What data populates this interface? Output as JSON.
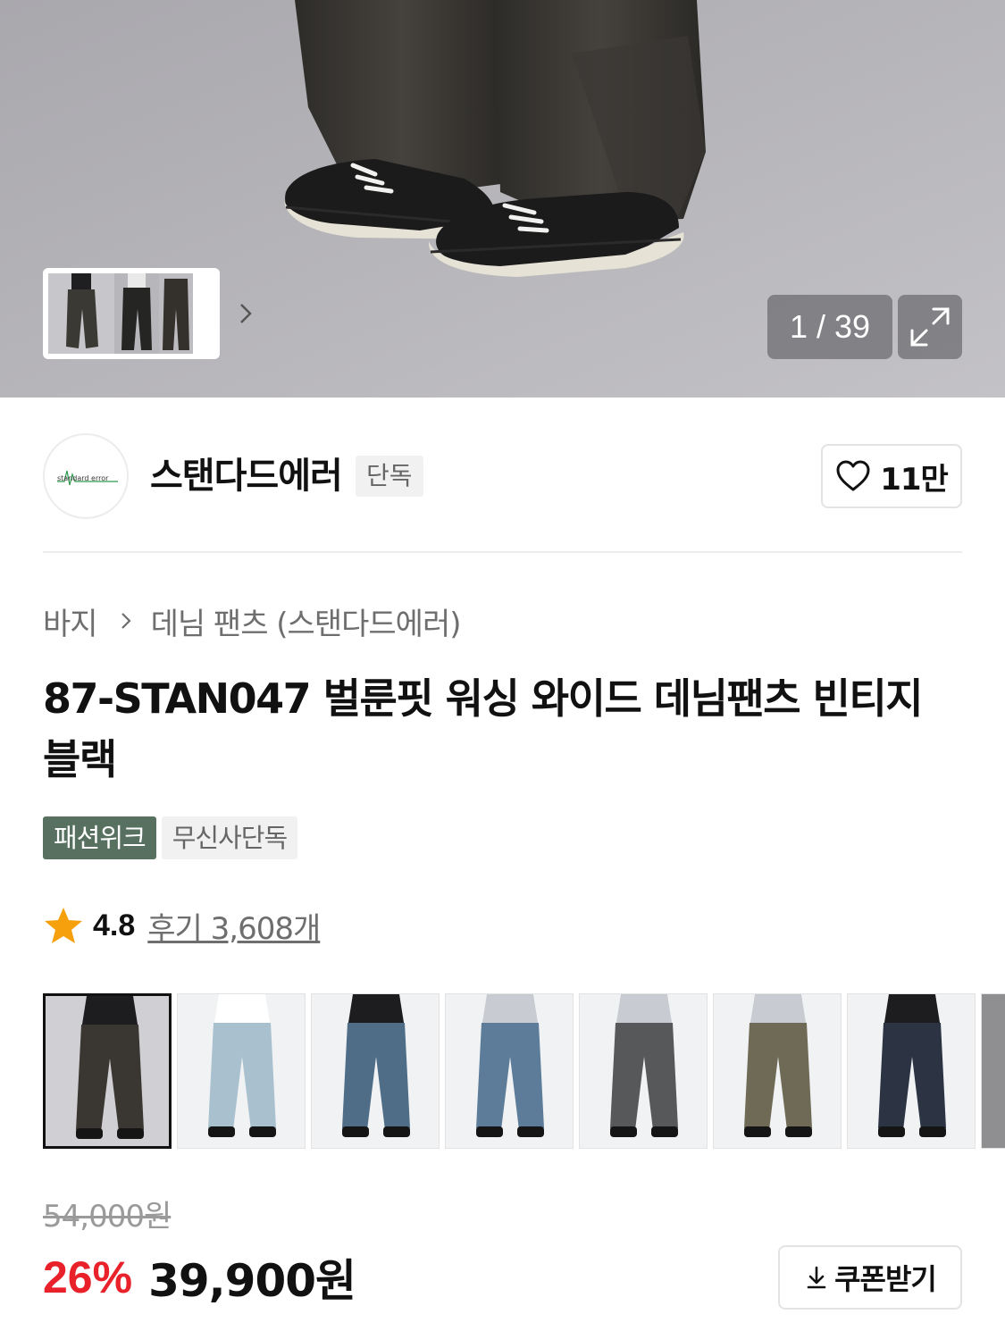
{
  "gallery": {
    "counter": "1 / 39",
    "next_icon": "chevron-right-icon",
    "expand_icon": "expand-icon"
  },
  "brand": {
    "name": "스탠다드에러",
    "tag": "단독",
    "logo_text": "standard error",
    "like_count": "11만",
    "like_icon": "heart-outline-icon"
  },
  "breadcrumb": {
    "category": "바지",
    "subcategory": "데님 팬츠 (스탠다드에러)"
  },
  "product": {
    "title": "87-STAN047 벌룬핏 워싱 와이드 데님팬츠 빈티지 블랙",
    "badges": [
      "패션위크",
      "무신사단독"
    ],
    "rating": "4.8",
    "reviews": "후기 3,608개"
  },
  "options": {
    "colors": [
      "#3a3732",
      "#a9c1cf",
      "#4f6d86",
      "#5d7c99",
      "#56585a",
      "#6f6a55",
      "#2c3444"
    ],
    "selected_index": 0
  },
  "price": {
    "original": "54,000원",
    "discount": "26%",
    "sale": "39,900원",
    "accent_color": "#e8212a"
  },
  "coupon": {
    "label": "쿠폰받기",
    "icon": "download-icon"
  }
}
